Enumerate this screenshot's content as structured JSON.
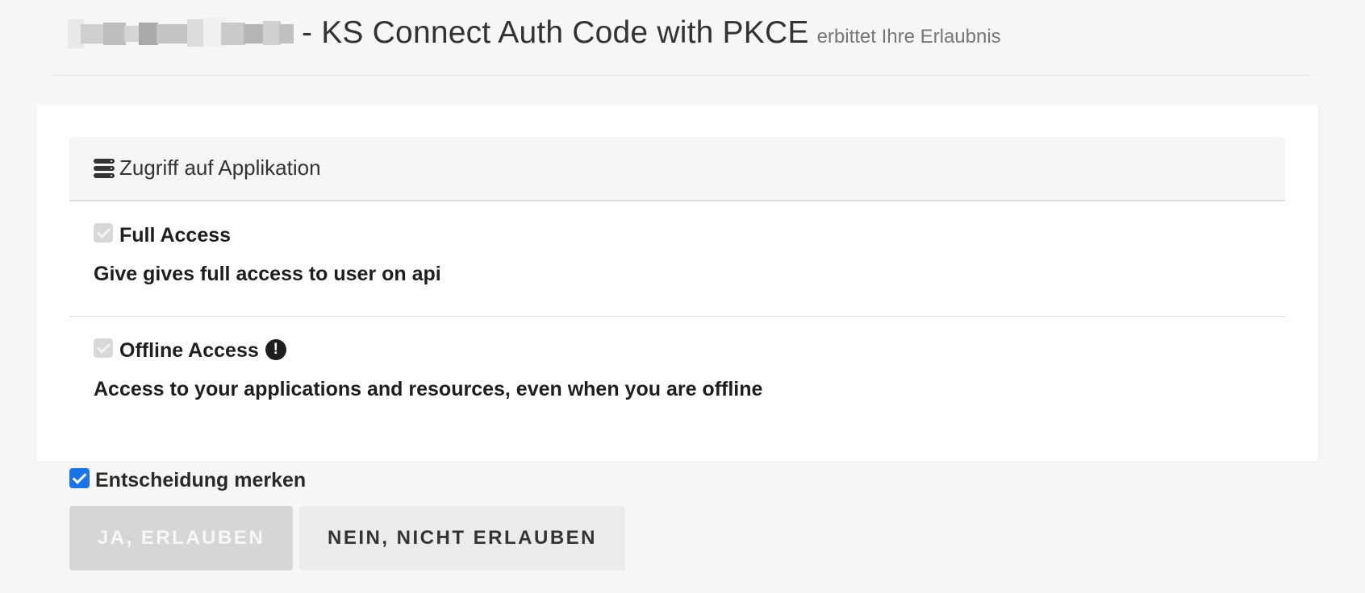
{
  "header": {
    "app_title": "- KS Connect Auth Code with PKCE",
    "subtitle": "erbittet Ihre Erlaubnis"
  },
  "panel": {
    "heading_icon": "database-icon",
    "heading": "Zugriff auf Applikation",
    "scopes": [
      {
        "title": "Full Access",
        "description": "Give gives full access to user on api",
        "checked": true,
        "disabled": true
      },
      {
        "title": "Offline Access",
        "description": "Access to your applications and resources, even when you are offline",
        "checked": true,
        "disabled": true,
        "icon": "exclamation-circle-icon"
      }
    ]
  },
  "remember": {
    "label": "Entscheidung merken",
    "checked": true
  },
  "buttons": {
    "allow": "JA, ERLAUBEN",
    "deny": "NEIN, NICHT ERLAUBEN"
  },
  "colors": {
    "page_background": "#f6f6f6",
    "panel_background": "#ffffff",
    "checkbox_accent": "#1a73e8",
    "allow_button_background": "#d7d5d5",
    "deny_button_background": "#ebebeb"
  }
}
